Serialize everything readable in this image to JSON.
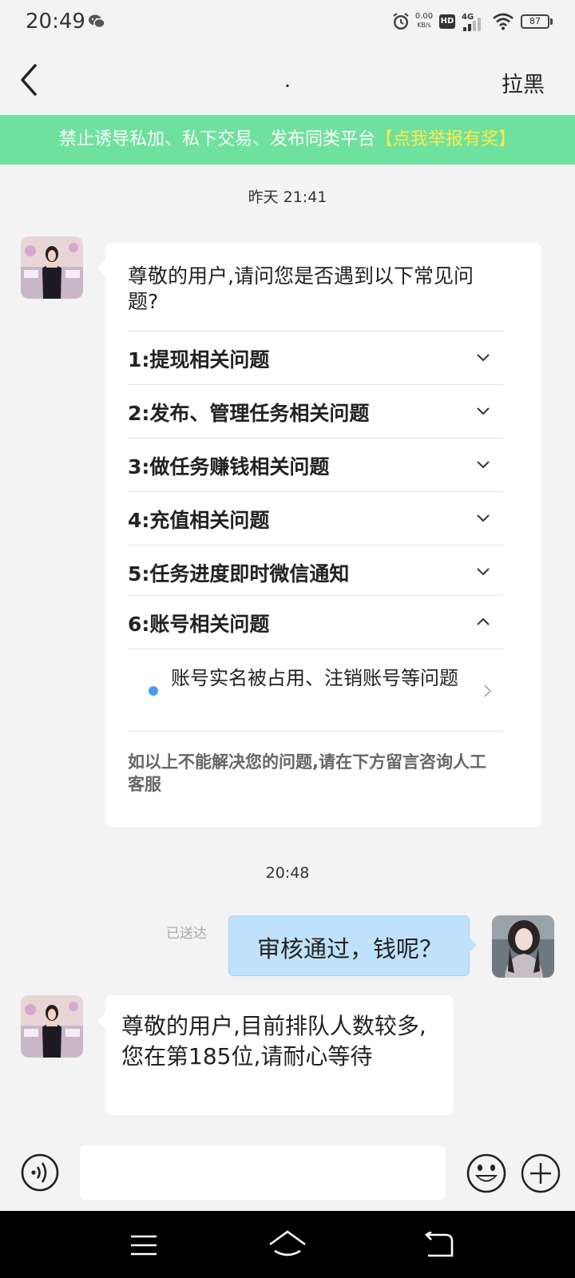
{
  "status_bar": {
    "time": "20:49",
    "net_speed_value": "0.00",
    "net_speed_unit": "KB/s",
    "hd_label": "HD",
    "network_label": "4G",
    "battery_level": "87"
  },
  "header": {
    "title": ".",
    "block_label": "拉黑"
  },
  "banner": {
    "text": "禁止诱导私加、私下交易、发布同类平台",
    "link": "【点我举报有奖】"
  },
  "messages": {
    "timestamp_1": "昨天 21:41",
    "faq": {
      "intro": "尊敬的用户,请问您是否遇到以下常见问题?",
      "items": [
        {
          "label": "1:提现相关问题",
          "expanded": false
        },
        {
          "label": "2:发布、管理任务相关问题",
          "expanded": false
        },
        {
          "label": "3:做任务赚钱相关问题",
          "expanded": false
        },
        {
          "label": "4:充值相关问题",
          "expanded": false
        },
        {
          "label": "5:任务进度即时微信通知",
          "expanded": false
        },
        {
          "label": "6:账号相关问题",
          "expanded": true
        }
      ],
      "sub_item": "账号实名被占用、注销账号等问题",
      "footer": "如以上不能解决您的问题,请在下方留言咨询人工客服"
    },
    "timestamp_2": "20:48",
    "sent": {
      "status": "已送达",
      "text": "审核通过，钱呢？"
    },
    "reply": {
      "text": "尊敬的用户,目前排队人数较多,您在第185位,请耐心等待"
    }
  },
  "input": {
    "value": "",
    "placeholder": ""
  },
  "colors": {
    "banner_bg": "#6fe19e",
    "banner_link": "#ffe84a",
    "sent_bubble": "#bfe1fb",
    "bullet": "#4a9af0"
  }
}
